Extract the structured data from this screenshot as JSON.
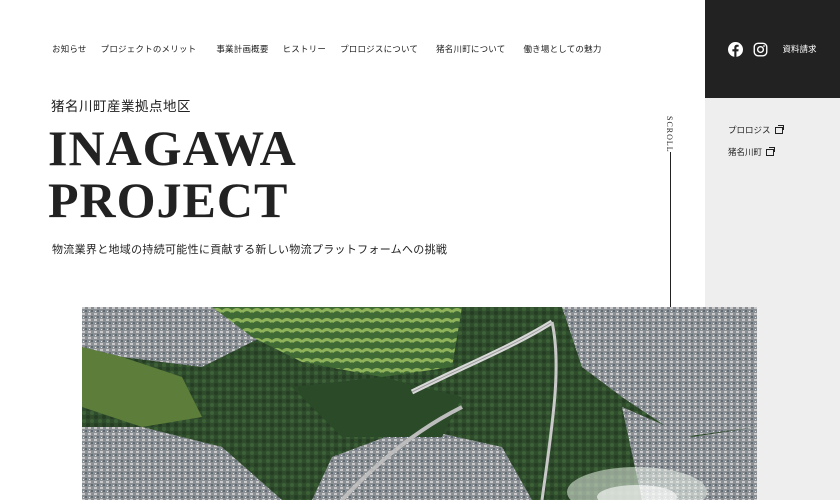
{
  "nav": {
    "items": [
      {
        "label": "お知らせ"
      },
      {
        "label": "プロジェクトのメリット"
      },
      {
        "label": "事業計画概要"
      },
      {
        "label": "ヒストリー"
      },
      {
        "label": "プロロジスについて"
      },
      {
        "label": "猪名川町について"
      },
      {
        "label": "働き場としての魅力"
      }
    ]
  },
  "header": {
    "facebook_icon": "facebook-icon",
    "instagram_icon": "instagram-icon",
    "request_label": "資料請求"
  },
  "side": {
    "links": [
      {
        "label": "プロロジス",
        "icon": "external-window-icon"
      },
      {
        "label": "猪名川町",
        "icon": "external-window-icon"
      }
    ]
  },
  "hero": {
    "subtitle": "猪名川町産業拠点地区",
    "title_line1": "INAGAWA",
    "title_line2": "PROJECT",
    "tagline": "物流業界と地域の持続可能性に貢献する新しい物流プラットフォームへの挑戦",
    "scroll_label": "SCROLL"
  },
  "colors": {
    "dark_panel": "#222222",
    "side_panel": "#eeeeee",
    "text": "#222222"
  }
}
